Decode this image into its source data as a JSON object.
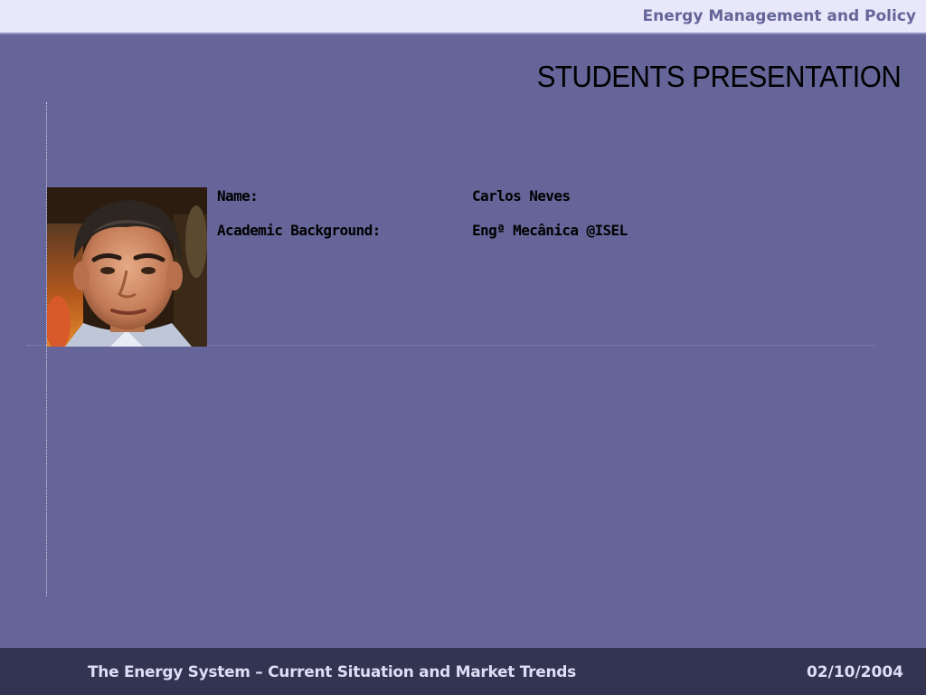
{
  "header": {
    "title": "Energy Management and Policy"
  },
  "slide": {
    "title": "STUDENTS PRESENTATION",
    "fields": [
      {
        "label": "Name:",
        "value": "Carlos Neves"
      },
      {
        "label": "Academic Background:",
        "value": "Engª Mecânica @ISEL"
      }
    ]
  },
  "footer": {
    "course": "The Energy System – Current Situation and Market Trends",
    "date": "02/10/2004"
  },
  "colors": {
    "slide_background": "#656599",
    "header_background": "#e8e8fa",
    "header_text": "#656599",
    "footer_background": "#333352",
    "footer_text": "#ddddf5"
  }
}
